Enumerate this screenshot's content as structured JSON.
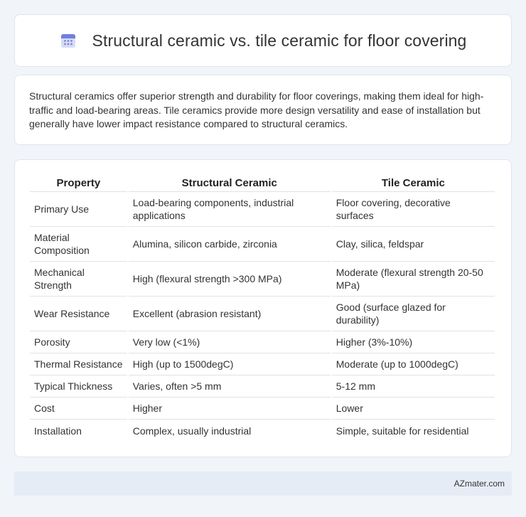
{
  "header": {
    "title": "Structural ceramic vs. tile ceramic for floor covering",
    "icon": "calendar-icon",
    "icon_colors": {
      "body": "#d6dcf5",
      "top": "#6f7fe0",
      "dots": "#7b86d6"
    }
  },
  "summary": {
    "text": "Structural ceramics offer superior strength and durability for floor coverings, making them ideal for high-traffic and load-bearing areas. Tile ceramics provide more design versatility and ease of installation but generally have lower impact resistance compared to structural ceramics."
  },
  "table": {
    "headers": [
      "Property",
      "Structural Ceramic",
      "Tile Ceramic"
    ],
    "rows": [
      [
        "Primary Use",
        "Load-bearing components, industrial applications",
        "Floor covering, decorative surfaces"
      ],
      [
        "Material Composition",
        "Alumina, silicon carbide, zirconia",
        "Clay, silica, feldspar"
      ],
      [
        "Mechanical Strength",
        "High (flexural strength >300 MPa)",
        "Moderate (flexural strength 20-50 MPa)"
      ],
      [
        "Wear Resistance",
        "Excellent (abrasion resistant)",
        "Good (surface glazed for durability)"
      ],
      [
        "Porosity",
        "Very low (<1%)",
        "Higher (3%-10%)"
      ],
      [
        "Thermal Resistance",
        "High (up to 1500degC)",
        "Moderate (up to 1000degC)"
      ],
      [
        "Typical Thickness",
        "Varies, often >5 mm",
        "5-12 mm"
      ],
      [
        "Cost",
        "Higher",
        "Lower"
      ],
      [
        "Installation",
        "Complex, usually industrial",
        "Simple, suitable for residential"
      ]
    ]
  },
  "footer": {
    "text": "AZmater.com"
  }
}
